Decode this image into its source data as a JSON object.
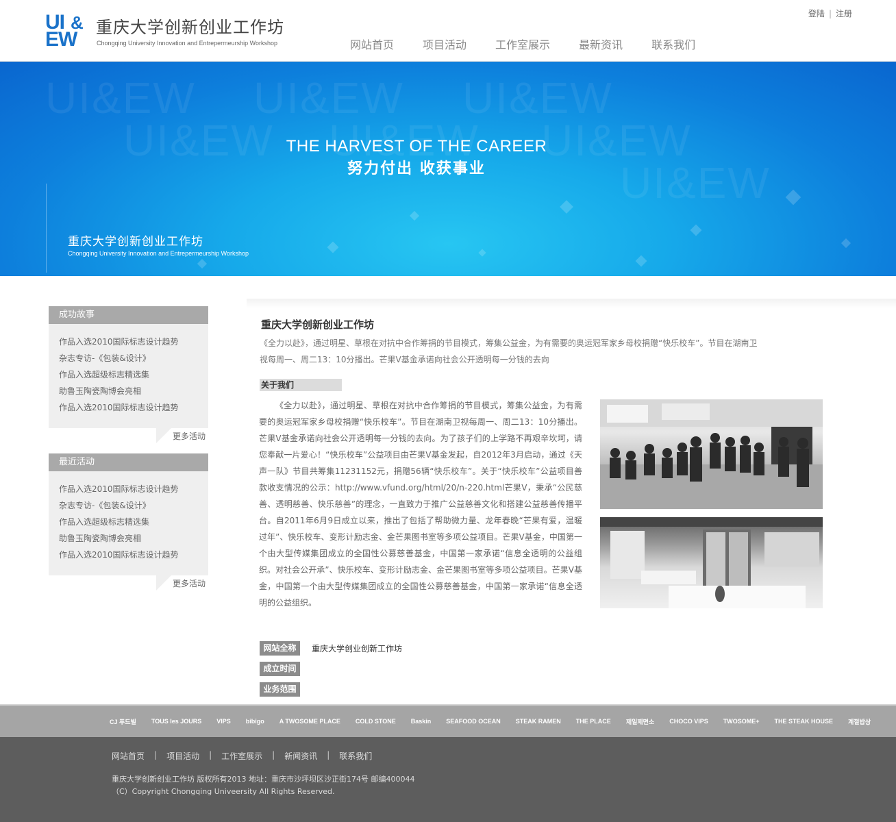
{
  "header": {
    "logo_line1": "UI",
    "logo_amp": "&",
    "logo_line2": "EW",
    "title": "重庆大学创新创业工作坊",
    "subtitle": "Chongqing University Innovation and Entrepermeurship Workshop",
    "login": "登陆",
    "register": "注册",
    "nav": [
      "网站首页",
      "项目活动",
      "工作室展示",
      "最新资讯",
      "联系我们"
    ]
  },
  "banner": {
    "watermark": "UI&EW",
    "headline_en": "THE HARVEST OF THE CAREER",
    "headline_cn": "努力付出 收获事业",
    "title": "重庆大学创新创业工作坊",
    "subtitle": "Chongqing University Innovation and Entrepermeurship Workshop"
  },
  "sidebar": {
    "success": {
      "heading": "成功故事",
      "items": [
        "作品入选2010国际标志设计趋势",
        "杂志专访-《包装&设计》",
        "作品入选超级标志精选集",
        "助鲁玉陶瓷陶博会亮相",
        "作品入选2010国际标志设计趋势"
      ],
      "more": "更多活动"
    },
    "recent": {
      "heading": "最近活动",
      "items": [
        "作品入选2010国际标志设计趋势",
        "杂志专访-《包装&设计》",
        "作品入选超级标志精选集",
        "助鲁玉陶瓷陶博会亮相",
        "作品入选2010国际标志设计趋势"
      ],
      "more": "更多活动"
    }
  },
  "main": {
    "title": "重庆大学创新创业工作坊",
    "intro": "《全力以赴》，通过明星、草根在对抗中合作筹捐的节目模式，筹集公益金，为有需要的奥运冠军家乡母校捐赠“快乐校车”。节目在湖南卫视每周一、周二13：10分播出。芒果V基金承诺向社会公开透明每一分钱的去向",
    "about_heading": "关于我们",
    "about_text": "《全力以赴》，通过明星、草根在对抗中合作筹捐的节目模式，筹集公益金，为有需要的奥运冠军家乡母校捐赠“快乐校车”。节目在湖南卫视每周一、周二13：10分播出。芒果V基金承诺向社会公开透明每一分钱的去向。为了孩子们的上学路不再艰辛坎坷，请您奉献一片爱心！“快乐校车”公益项目由芒果V基金发起，自2012年3月启动，通过《天声一队》节目共筹集11231152元，捐赠56辆“快乐校车”。关于“快乐校车”公益项目善款收支情况的公示：http://www.vfund.org/html/20/n-220.html芒果V，秉承“公民慈善、透明慈善、快乐慈善”的理念，一直致力于推广公益慈善文化和搭建公益慈善传播平台。自2011年6月9日成立以来，推出了包括了帮助微力量、龙年春晚“芒果有爱，温暖过年”、快乐校车、变形计励志金、金芒果图书室等多项公益项目。芒果V基金，中国第一个由大型传媒集团成立的全国性公募慈善基金，中国第一家承诺“信息全透明的公益组织。对社会公开承”、快乐校车、变形计励志金、金芒果图书室等多项公益项目。芒果V基金，中国第一个由大型传媒集团成立的全国性公募慈善基金，中国第一家承诺“信息全透明的公益组织。",
    "info": [
      {
        "label": "网站全称",
        "value": "重庆大学创业创新工作坊"
      },
      {
        "label": "成立时间",
        "value": ""
      },
      {
        "label": "业务范围",
        "value": ""
      }
    ]
  },
  "brands": [
    "CJ 푸드빌",
    "TOUS les JOURS",
    "VIPS",
    "bibigo",
    "A TWOSOME PLACE",
    "COLD STONE",
    "Baskin",
    "SEAFOOD OCEAN",
    "STEAK RAMEN",
    "THE PLACE",
    "제일제면소",
    "CHOCO VIPS",
    "TWOSOME+",
    "THE STEAK HOUSE",
    "계절밥상"
  ],
  "footer": {
    "nav": [
      "网站首页",
      "项目活动",
      "工作室展示",
      "新闻资讯",
      "联系我们"
    ],
    "copyright": "重庆大学创新创业工作坊 版权所有2013  地址：重庆市沙坪坝区沙正街174号  邮编400044",
    "copyright_en": "（C）Copyright Chongqing Univeersity All Rights Reserved."
  }
}
